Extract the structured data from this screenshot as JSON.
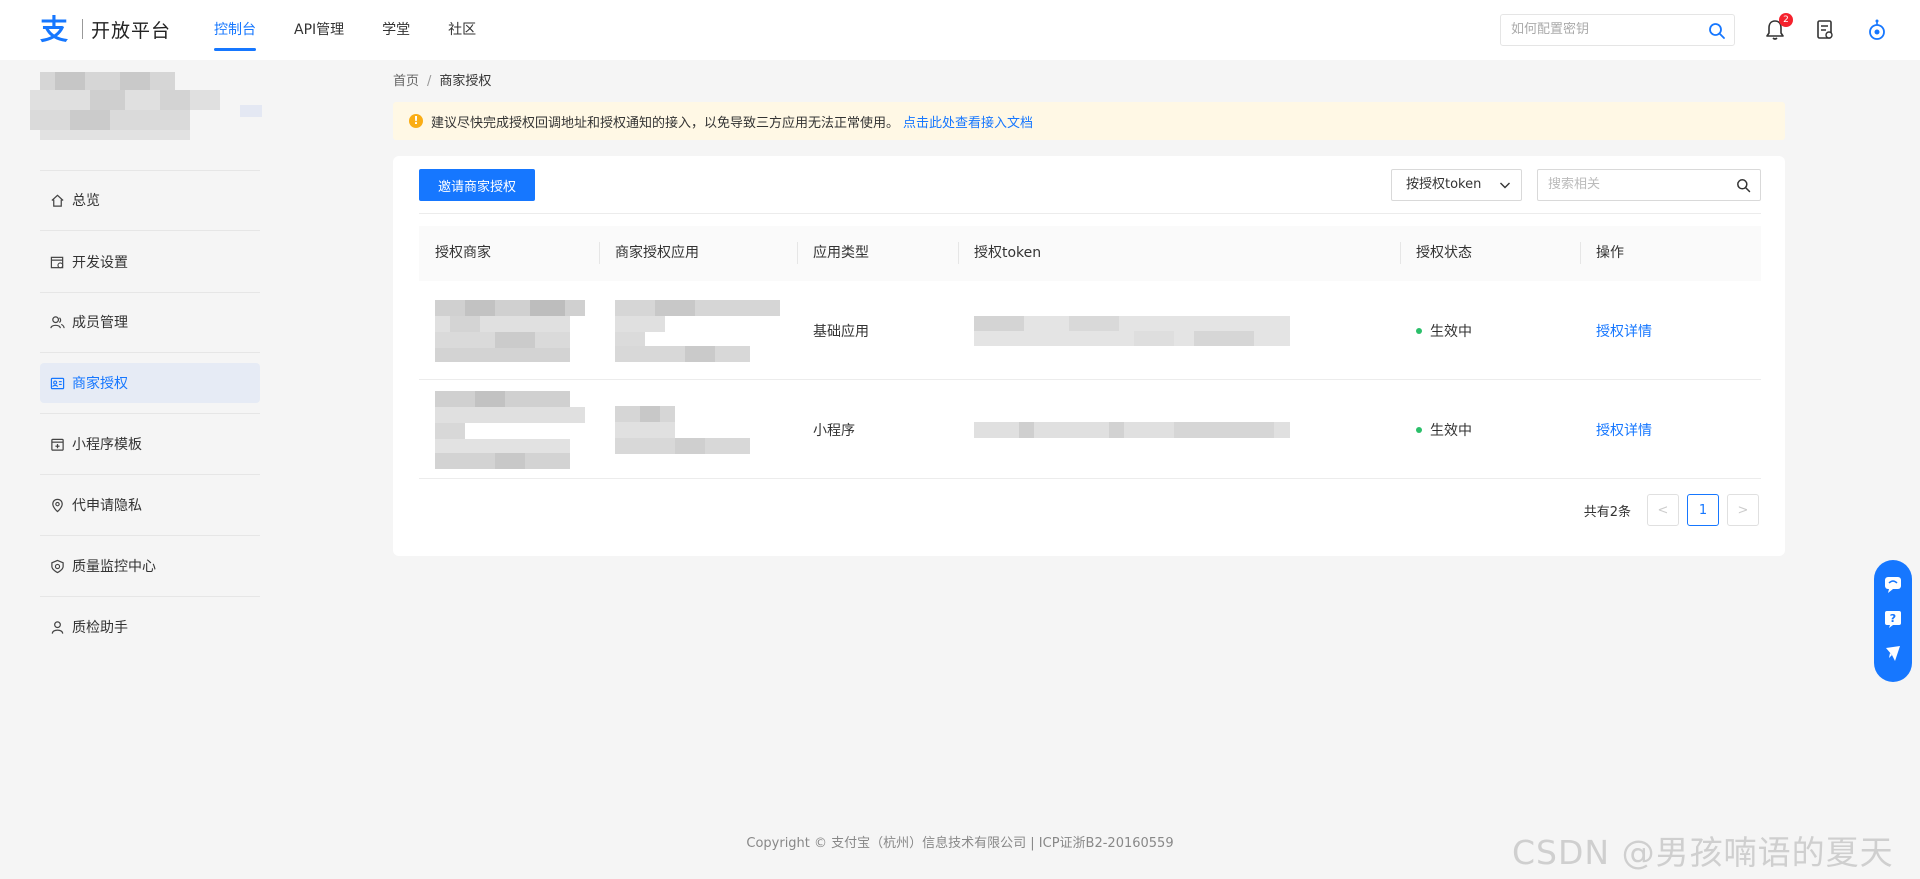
{
  "header": {
    "logo_text": "开放平台",
    "nav": [
      {
        "label": "控制台",
        "active": true
      },
      {
        "label": "API管理",
        "active": false
      },
      {
        "label": "学堂",
        "active": false
      },
      {
        "label": "社区",
        "active": false
      }
    ],
    "search_placeholder": "如何配置密钥",
    "notification_count": "2",
    "icons": [
      "search-icon",
      "bell-icon",
      "document-icon",
      "robot-icon"
    ],
    "accent_color": "#1677ff"
  },
  "sidebar": {
    "items": [
      {
        "label": "总览",
        "icon": "home-icon",
        "active": false
      },
      {
        "label": "开发设置",
        "icon": "dev-settings-icon",
        "active": false
      },
      {
        "label": "成员管理",
        "icon": "members-icon",
        "active": false
      },
      {
        "label": "商家授权",
        "icon": "merchant-auth-icon",
        "active": true
      },
      {
        "label": "小程序模板",
        "icon": "template-icon",
        "active": false
      },
      {
        "label": "代申请隐私",
        "icon": "privacy-icon",
        "active": false
      },
      {
        "label": "质量监控中心",
        "icon": "quality-monitor-icon",
        "active": false
      },
      {
        "label": "质检助手",
        "icon": "user-icon",
        "active": false
      }
    ]
  },
  "breadcrumb": {
    "home": "首页",
    "separator": "/",
    "current": "商家授权"
  },
  "alert": {
    "text": "建议尽快完成授权回调地址和授权通知的接入，以免导致三方应用无法正常使用。",
    "link": "点击此处查看接入文档"
  },
  "toolbar": {
    "invite_button": "邀请商家授权",
    "filter_select": "按授权token",
    "search_placeholder": "搜索相关"
  },
  "table": {
    "columns": [
      "授权商家",
      "商家授权应用",
      "应用类型",
      "授权token",
      "授权状态",
      "操作"
    ],
    "rows": [
      {
        "app_type": "基础应用",
        "status": "生效中",
        "action": "授权详情"
      },
      {
        "app_type": "小程序",
        "status": "生效中",
        "action": "授权详情"
      }
    ]
  },
  "pagination": {
    "total": "共有2条",
    "current_page": "1",
    "prev": "<",
    "next": ">"
  },
  "footer": "Copyright © 支付宝（杭州）信息技术有限公司 | ICP证浙B2-20160559",
  "watermark": "CSDN @男孩喃语的夏天"
}
